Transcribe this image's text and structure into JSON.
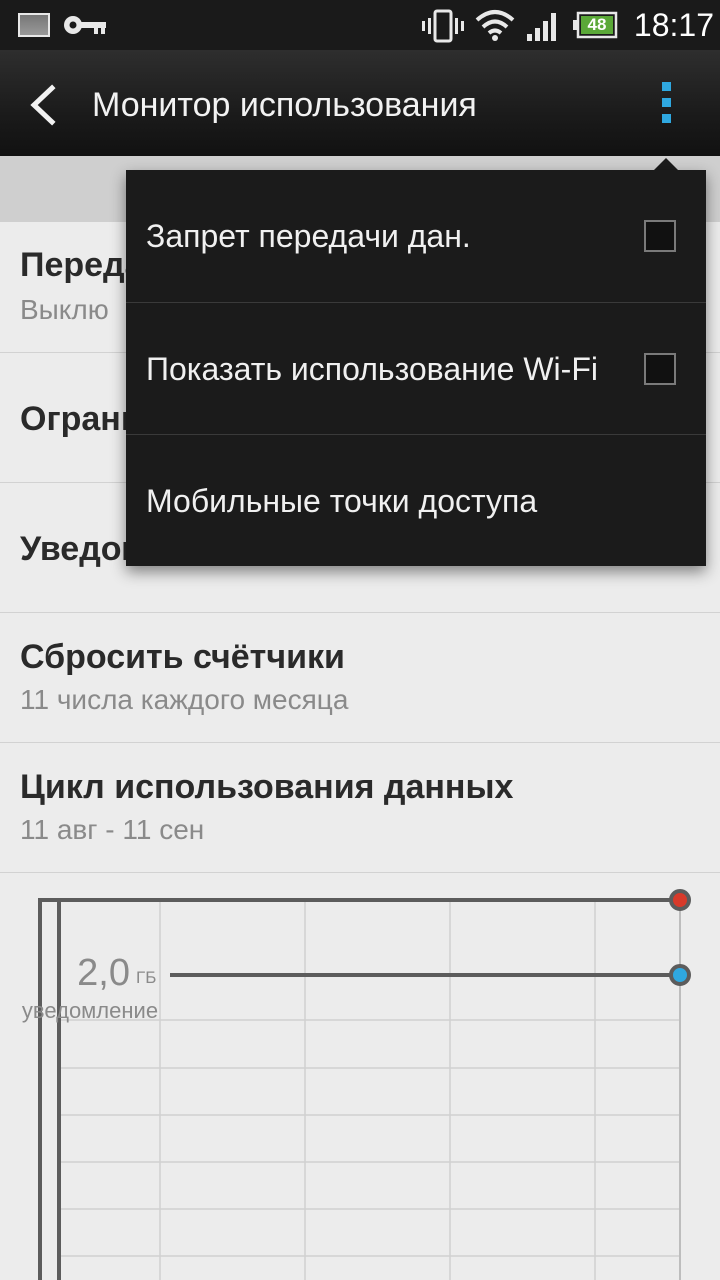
{
  "status_bar": {
    "time": "18:17",
    "battery_level": "48",
    "icons": [
      "image-icon",
      "key-icon",
      "vibrate-icon",
      "wifi-icon",
      "signal-icon",
      "battery-icon"
    ]
  },
  "action_bar": {
    "title": "Монитор использования",
    "back_icon": "chevron-left-icon",
    "overflow_icon": "overflow-menu-icon",
    "accent_color": "#2fa8e0"
  },
  "settings": {
    "items": [
      {
        "title": "Переда",
        "subtitle": "Выклю"
      },
      {
        "title": "Ограни"
      },
      {
        "title": "Уведом"
      },
      {
        "title": "Сбросить счётчики",
        "subtitle": "11 числа каждого месяца"
      },
      {
        "title": "Цикл использования данных",
        "subtitle": "11 авг - 11 сен"
      }
    ]
  },
  "chart": {
    "warning_value": "2,0",
    "warning_unit": "ГБ",
    "warning_label": "уведомление",
    "limit_color": "#d83a2a",
    "warning_color": "#2fa8e0"
  },
  "menu": {
    "items": [
      {
        "label": "Запрет передачи дан.",
        "checkbox": true,
        "checked": false
      },
      {
        "label": "Показать использование Wi-Fi",
        "checkbox": true,
        "checked": false
      },
      {
        "label": "Мобильные точки доступа",
        "checkbox": false
      }
    ]
  }
}
